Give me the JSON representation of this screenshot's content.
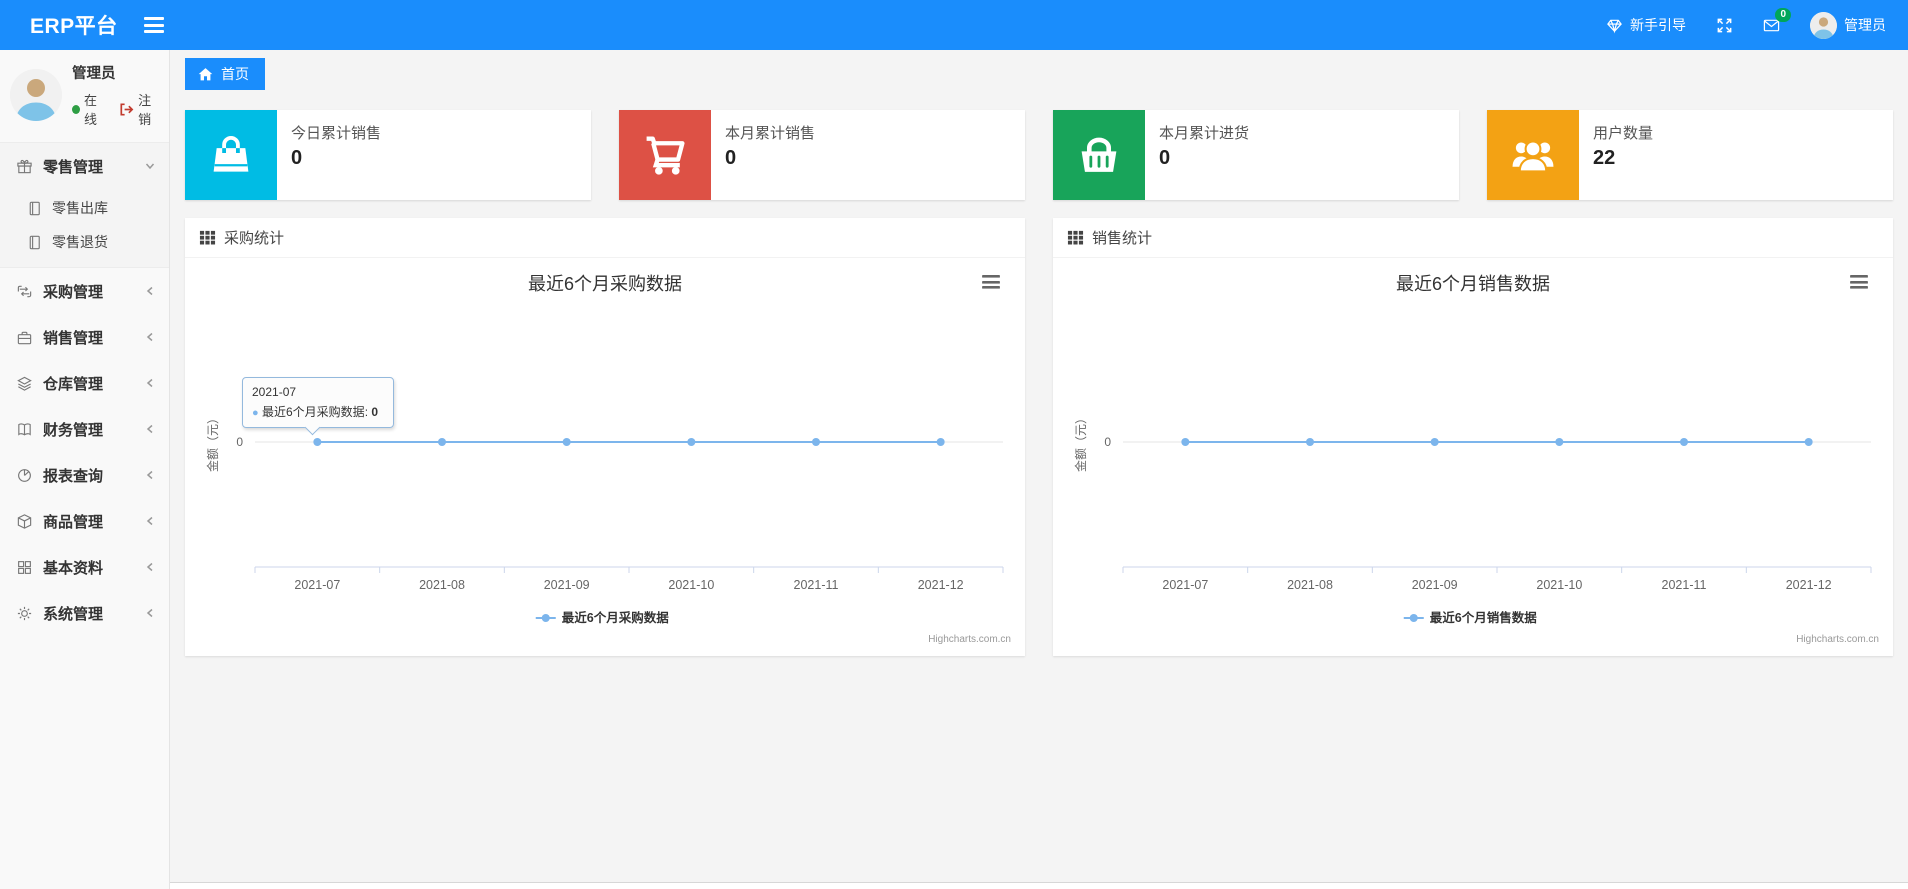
{
  "navbar": {
    "brand": "ERP平台",
    "guide_label": "新手引导",
    "message_badge": "0",
    "username": "管理员",
    "accent_color": "#1a8dfc"
  },
  "sidebar": {
    "user": {
      "name": "管理员",
      "status_label": "在线",
      "logout_label": "注销"
    },
    "menu": [
      {
        "label": "零售管理",
        "icon": "gift-icon",
        "state": "expanded",
        "children": [
          {
            "label": "零售出库",
            "icon": "book-icon"
          },
          {
            "label": "零售退货",
            "icon": "book-icon"
          }
        ]
      },
      {
        "label": "采购管理",
        "icon": "repeat-icon",
        "state": "collapsed"
      },
      {
        "label": "销售管理",
        "icon": "briefcase-icon",
        "state": "collapsed"
      },
      {
        "label": "仓库管理",
        "icon": "layers-icon",
        "state": "collapsed"
      },
      {
        "label": "财务管理",
        "icon": "book-open-icon",
        "state": "collapsed"
      },
      {
        "label": "报表查询",
        "icon": "pie-chart-icon",
        "state": "collapsed"
      },
      {
        "label": "商品管理",
        "icon": "package-icon",
        "state": "collapsed"
      },
      {
        "label": "基本资料",
        "icon": "grid-icon",
        "state": "collapsed"
      },
      {
        "label": "系统管理",
        "icon": "gear-icon",
        "state": "collapsed"
      }
    ]
  },
  "breadcrumb": {
    "home_label": "首页"
  },
  "stat_cards": [
    {
      "label": "今日累计销售",
      "value": "0",
      "icon": "shopping-bag-icon",
      "color": "#00bce4"
    },
    {
      "label": "本月累计销售",
      "value": "0",
      "icon": "shopping-cart-icon",
      "color": "#dd5145"
    },
    {
      "label": "本月累计进货",
      "value": "0",
      "icon": "shopping-basket-icon",
      "color": "#18a45a"
    },
    {
      "label": "用户数量",
      "value": "22",
      "icon": "users-icon",
      "color": "#f3a214"
    }
  ],
  "panels": [
    {
      "header": "采购统计"
    },
    {
      "header": "销售统计"
    }
  ],
  "chart_data": [
    {
      "type": "line",
      "title": "最近6个月采购数据",
      "categories": [
        "2021-07",
        "2021-08",
        "2021-09",
        "2021-10",
        "2021-11",
        "2021-12"
      ],
      "series": [
        {
          "name": "最近6个月采购数据",
          "values": [
            0,
            0,
            0,
            0,
            0,
            0
          ],
          "color": "#7cb5ec"
        }
      ],
      "ylabel": "金额（元）",
      "yticks": [
        "0"
      ],
      "ylim": [
        0,
        0
      ],
      "grid": true,
      "legend_position": "bottom",
      "credit": "Highcharts.com.cn",
      "tooltip": {
        "visible": true,
        "category": "2021-07",
        "series_name": "最近6个月采购数据",
        "separator": ": ",
        "value": "0"
      }
    },
    {
      "type": "line",
      "title": "最近6个月销售数据",
      "categories": [
        "2021-07",
        "2021-08",
        "2021-09",
        "2021-10",
        "2021-11",
        "2021-12"
      ],
      "series": [
        {
          "name": "最近6个月销售数据",
          "values": [
            0,
            0,
            0,
            0,
            0,
            0
          ],
          "color": "#7cb5ec"
        }
      ],
      "ylabel": "金额（元）",
      "yticks": [
        "0"
      ],
      "ylim": [
        0,
        0
      ],
      "grid": true,
      "legend_position": "bottom",
      "credit": "Highcharts.com.cn",
      "tooltip": {
        "visible": false
      }
    }
  ]
}
